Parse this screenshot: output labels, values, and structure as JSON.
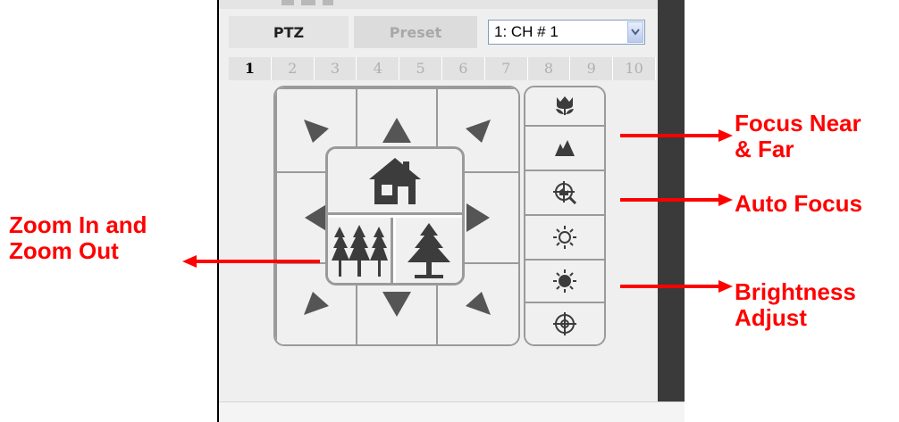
{
  "tabs": {
    "ptz": "PTZ",
    "preset": "Preset"
  },
  "channel_select": {
    "value": "1: CH # 1"
  },
  "preset_numbers": [
    "1",
    "2",
    "3",
    "4",
    "5",
    "6",
    "7",
    "8",
    "9",
    "10"
  ],
  "preset_active": "1",
  "annotations": {
    "focus_line1": "Focus Near",
    "focus_line2": "& Far",
    "auto_focus": "Auto Focus",
    "zoom_line1": "Zoom In and",
    "zoom_line2": "Zoom Out",
    "brightness_line1": "Brightness",
    "brightness_line2": "Adjust"
  },
  "icons": {
    "focus_near": "flower-icon",
    "focus_far": "mountain-icon",
    "auto_focus": "target-icon",
    "brightness_up": "sun-icon",
    "brightness_down": "sun-dark-icon",
    "brightness_reset": "target-circle-icon",
    "home": "home-icon",
    "zoom_out": "trees-icon",
    "zoom_in": "tree-icon",
    "channel_dropdown": "chevron-down-icon"
  },
  "colors": {
    "annotation": "#ff0000",
    "arrow_gray": "#555555",
    "icon_dark": "#3c3c3c"
  }
}
